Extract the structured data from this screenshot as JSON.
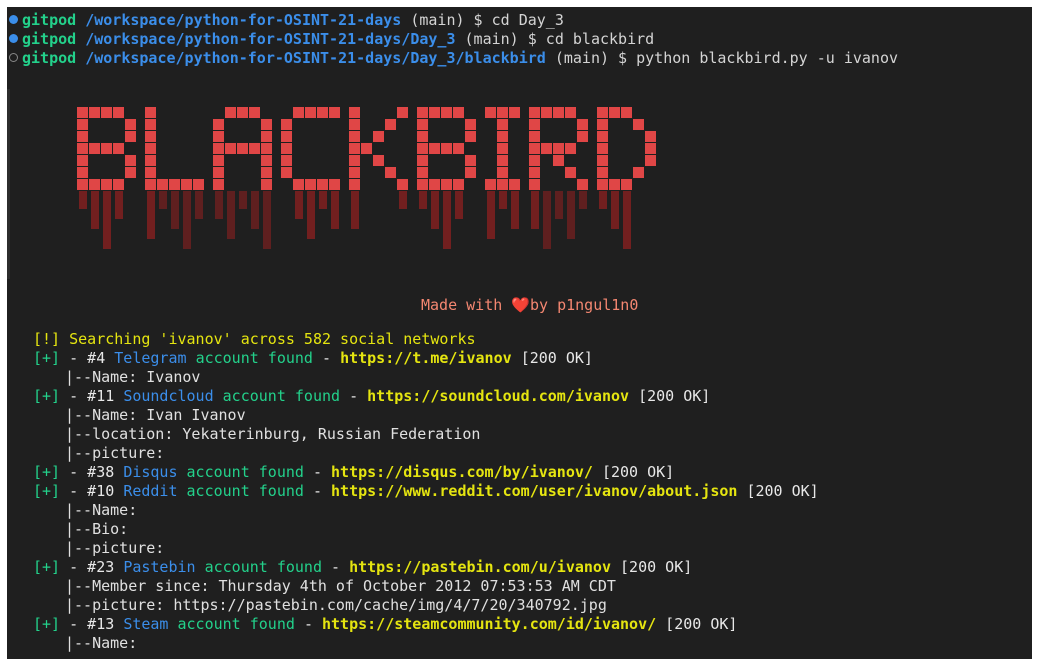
{
  "prompts": [
    {
      "dot": "filled",
      "host": "gitpod",
      "path": "/workspace/python-for-OSINT-21-days",
      "branch": "(main)",
      "symbol": "$",
      "command": "cd Day_3"
    },
    {
      "dot": "filled",
      "host": "gitpod",
      "path": "/workspace/python-for-OSINT-21-days/Day_3",
      "branch": "(main)",
      "symbol": "$",
      "command": "cd blackbird"
    },
    {
      "dot": "hollow",
      "host": "gitpod",
      "path": "/workspace/python-for-OSINT-21-days/Day_3/blackbird",
      "branch": "(main)",
      "symbol": "$",
      "command": "python blackbird.py -u ivanov"
    }
  ],
  "banner": {
    "text": "BLACKBIRD",
    "color": "#e04646",
    "shadow_color": "#7a1f1f"
  },
  "made_with": {
    "prefix": "Made with ",
    "heart": "❤️",
    "suffix": "by p1ngul1n0"
  },
  "search_line": "[!] Searching 'ivanov' across 582 social networks",
  "results": [
    {
      "tag": "[+]",
      "num": "- #4",
      "site": "Telegram",
      "found": "account found",
      "dash": "-",
      "url": "https://t.me/ivanov",
      "status": "[200 OK]",
      "details": [
        "|--Name: Ivanov"
      ]
    },
    {
      "tag": "[+]",
      "num": "- #11",
      "site": "Soundcloud",
      "found": "account found",
      "dash": "-",
      "url": "https://soundcloud.com/ivanov",
      "status": "[200 OK]",
      "details": [
        "|--Name: Ivan Ivanov",
        "|--location: Yekaterinburg, Russian Federation",
        "|--picture:"
      ]
    },
    {
      "tag": "[+]",
      "num": "- #38",
      "site": "Disqus",
      "found": "account found",
      "dash": "-",
      "url": "https://disqus.com/by/ivanov/",
      "status": "[200 OK]",
      "details": []
    },
    {
      "tag": "[+]",
      "num": "- #10",
      "site": "Reddit",
      "found": "account found",
      "dash": "-",
      "url": "https://www.reddit.com/user/ivanov/about.json",
      "status": "[200 OK]",
      "details": [
        "|--Name:",
        "|--Bio:",
        "|--picture:"
      ]
    },
    {
      "tag": "[+]",
      "num": "- #23",
      "site": "Pastebin",
      "found": "account found",
      "dash": "-",
      "url": "https://pastebin.com/u/ivanov",
      "status": "[200 OK]",
      "details": [
        "|--Member since: Thursday 4th of October 2012 07:53:53 AM CDT",
        "|--picture: https://pastebin.com/cache/img/4/7/20/340792.jpg"
      ]
    },
    {
      "tag": "[+]",
      "num": "- #13",
      "site": "Steam",
      "found": "account found",
      "dash": "-",
      "url": "https://steamcommunity.com/id/ivanov/",
      "status": "[200 OK]",
      "details": [
        "|--Name:"
      ]
    }
  ]
}
